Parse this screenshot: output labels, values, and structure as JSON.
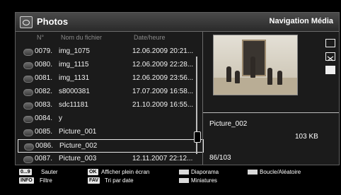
{
  "header": {
    "title": "Photos",
    "mode": "Navigation Média"
  },
  "columns": {
    "num": "N°",
    "name": "Nom du fichier",
    "date": "Date/heure"
  },
  "rows": [
    {
      "num": "0079.",
      "name": "img_1075",
      "date": "12.06.2009 20:21..."
    },
    {
      "num": "0080.",
      "name": "img_1115",
      "date": "12.06.2009 22:28..."
    },
    {
      "num": "0081.",
      "name": "img_1131",
      "date": "12.06.2009 23:56..."
    },
    {
      "num": "0082.",
      "name": "s8000381",
      "date": "17.07.2009 16:58..."
    },
    {
      "num": "0083.",
      "name": "sdc11181",
      "date": "21.10.2009 16:55..."
    },
    {
      "num": "0084.",
      "name": "y",
      "date": ""
    },
    {
      "num": "0085.",
      "name": "Picture_001",
      "date": ""
    },
    {
      "num": "0086.",
      "name": "Picture_002",
      "date": ""
    },
    {
      "num": "0087.",
      "name": "Picture_003",
      "date": "12.11.2007 22:12..."
    }
  ],
  "selected_index": 7,
  "info": {
    "name": "Picture_002",
    "size": "103 KB",
    "position": "86/103"
  },
  "footer": {
    "sauter_key": "0...9",
    "sauter": "Sauter",
    "info_key": "INFO",
    "filtre": "Filtre",
    "ok_key": "OK",
    "plein_ecran": "Afficher plein écran",
    "fav_key": "FAV",
    "tri": "Tri par date",
    "diaporama": "Diaporama",
    "miniatures": "Miniatures",
    "boucle": "Boucle/Aléatoire"
  },
  "icons": [
    "photo-icon",
    "repeat-icon",
    "shuffle-icon",
    "stop-icon",
    "bullet-icon"
  ]
}
